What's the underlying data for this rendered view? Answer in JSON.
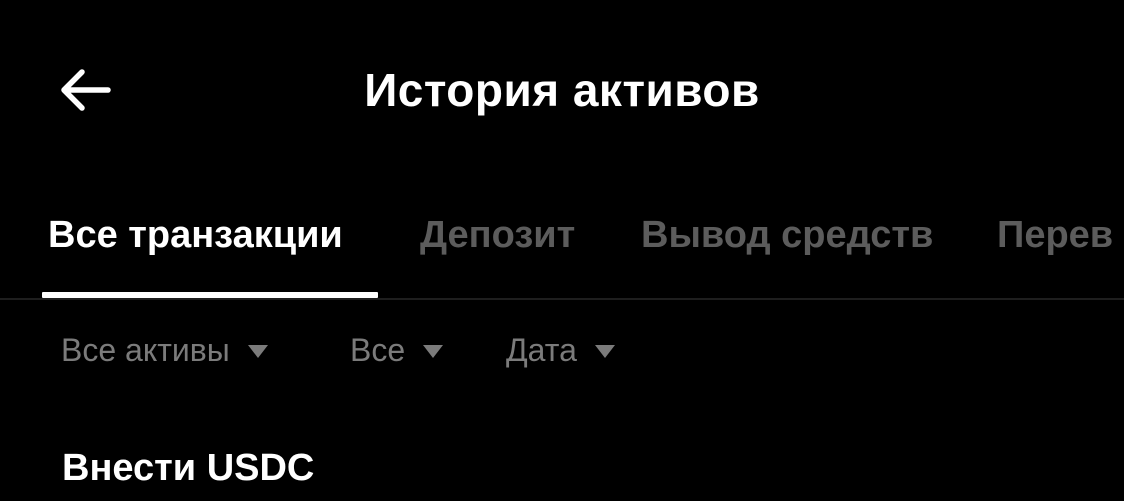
{
  "header": {
    "title": "История активов",
    "back_icon": "arrow-left-icon"
  },
  "tabs": [
    {
      "label": "Все транзакции",
      "active": true
    },
    {
      "label": "Депозит",
      "active": false
    },
    {
      "label": "Вывод средств",
      "active": false
    },
    {
      "label": "Перев",
      "active": false
    }
  ],
  "filters": [
    {
      "label": "Все активы",
      "icon": "caret-down-icon"
    },
    {
      "label": "Все",
      "icon": "caret-down-icon"
    },
    {
      "label": "Дата",
      "icon": "caret-down-icon"
    }
  ],
  "transactions": [
    {
      "title": "Внести USDC"
    }
  ],
  "colors": {
    "background": "#000000",
    "text_primary": "#ffffff",
    "text_inactive": "#5c5c5c",
    "filter_text": "#7b7b7b",
    "divider": "#1e1e1e"
  }
}
